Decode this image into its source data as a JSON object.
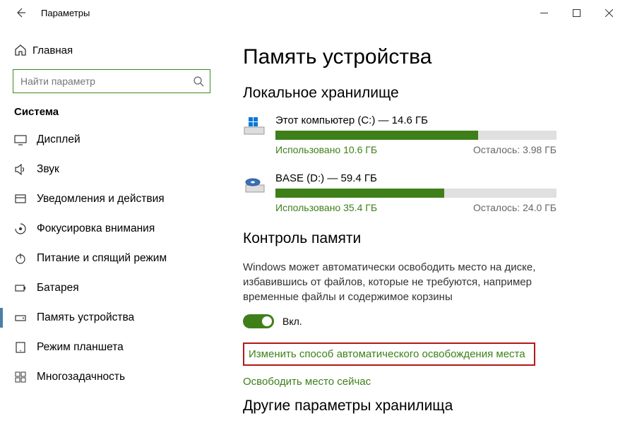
{
  "window": {
    "title": "Параметры"
  },
  "sidebar": {
    "home": "Главная",
    "search_placeholder": "Найти параметр",
    "section": "Система",
    "items": [
      {
        "label": "Дисплей"
      },
      {
        "label": "Звук"
      },
      {
        "label": "Уведомления и действия"
      },
      {
        "label": "Фокусировка внимания"
      },
      {
        "label": "Питание и спящий режим"
      },
      {
        "label": "Батарея"
      },
      {
        "label": "Память устройства"
      },
      {
        "label": "Режим планшета"
      },
      {
        "label": "Многозадачность"
      }
    ]
  },
  "main": {
    "title": "Память устройства",
    "local_storage_heading": "Локальное хранилище",
    "drives": [
      {
        "name": "Этот компьютер (C:) — 14.6 ГБ",
        "used_label": "Использовано 10.6 ГБ",
        "free_label": "Осталось: 3.98 ГБ",
        "fill_pct": 72
      },
      {
        "name": "BASE (D:) — 59.4 ГБ",
        "used_label": "Использовано 35.4 ГБ",
        "free_label": "Осталось: 24.0 ГБ",
        "fill_pct": 60
      }
    ],
    "storage_sense_heading": "Контроль памяти",
    "storage_sense_desc": "Windows может автоматически освободить место на диске, избавившись от файлов, которые не требуются, например временные файлы и содержимое корзины",
    "toggle_label": "Вкл.",
    "link_change": "Изменить способ автоматического освобождения места",
    "link_free_now": "Освободить место сейчас",
    "other_heading": "Другие параметры хранилища"
  }
}
